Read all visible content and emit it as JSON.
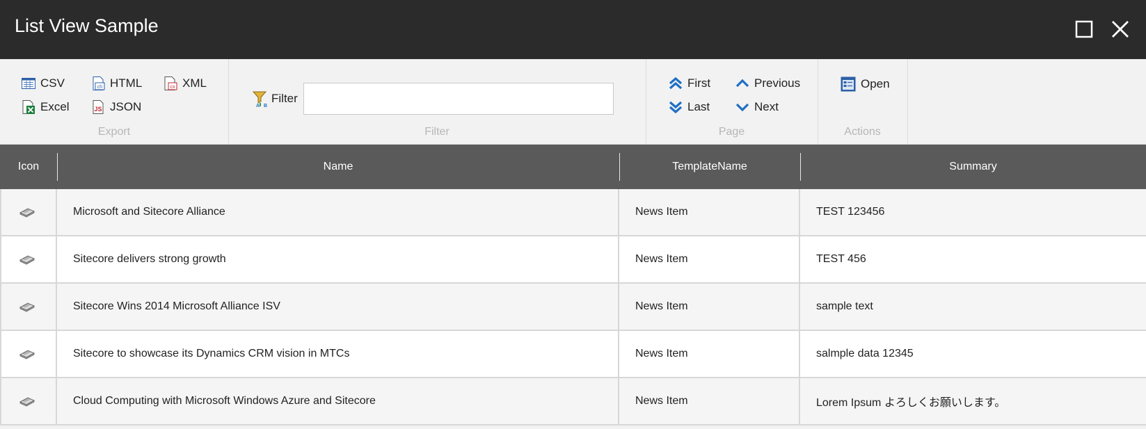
{
  "window": {
    "title": "List View Sample"
  },
  "ribbon": {
    "export": {
      "caption": "Export",
      "csv": "CSV",
      "html": "HTML",
      "xml": "XML",
      "excel": "Excel",
      "json": "JSON"
    },
    "filter": {
      "caption": "Filter",
      "label": "Filter",
      "value": ""
    },
    "page": {
      "caption": "Page",
      "first": "First",
      "previous": "Previous",
      "last": "Last",
      "next": "Next"
    },
    "actions": {
      "caption": "Actions",
      "open": "Open"
    }
  },
  "table": {
    "columns": [
      "Icon",
      "Name",
      "TemplateName",
      "Summary"
    ],
    "rows": [
      {
        "name": "Microsoft and Sitecore Alliance",
        "template": "News Item",
        "summary": "TEST 123456"
      },
      {
        "name": "Sitecore delivers strong growth",
        "template": "News Item",
        "summary": "TEST 456"
      },
      {
        "name": "Sitecore Wins 2014 Microsoft Alliance ISV",
        "template": "News Item",
        "summary": "sample text"
      },
      {
        "name": "Sitecore to showcase its Dynamics CRM vision in MTCs",
        "template": "News Item",
        "summary": "salmple data 12345"
      },
      {
        "name": "Cloud Computing with Microsoft Windows Azure and Sitecore",
        "template": "News Item",
        "summary": "Lorem Ipsum よろしくお願いします。"
      }
    ]
  },
  "colors": {
    "titlebar": "#2b2b2b",
    "header": "#5a5a5a",
    "accent_blue": "#1f6fc5"
  },
  "icons": {
    "row_icon": "news-item-icon",
    "csv": "csv-file-icon",
    "html": "html-file-icon",
    "xml": "xml-file-icon",
    "excel": "excel-file-icon",
    "json": "json-file-icon",
    "filter": "filter-funnel-icon",
    "first": "double-chevron-up-icon",
    "previous": "chevron-up-icon",
    "last": "double-chevron-down-icon",
    "next": "chevron-down-icon",
    "open": "open-window-icon"
  }
}
